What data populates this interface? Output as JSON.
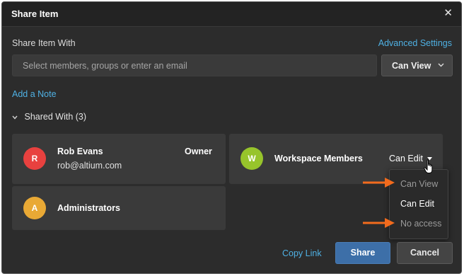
{
  "dialog": {
    "title": "Share Item",
    "close_glyph": "✕"
  },
  "share_with": {
    "label": "Share Item With",
    "advanced_link": "Advanced Settings",
    "input_placeholder": "Select members, groups or enter an email",
    "permission_value": "Can View",
    "permission_chevron": "⌄"
  },
  "add_note": "Add a Note",
  "shared_with": {
    "label": "Shared With (3)",
    "chevron": "⌄"
  },
  "members": [
    {
      "initial": "R",
      "name": "Rob Evans",
      "email": "rob@altium.com",
      "role": "Owner",
      "color": "#e8413f"
    },
    {
      "initial": "W",
      "name": "Workspace Members",
      "permission": "Can Edit",
      "color": "#97c42b"
    },
    {
      "initial": "A",
      "name": "Administrators",
      "color": "#e9a935"
    }
  ],
  "permission_menu": {
    "items": [
      "Can View",
      "Can Edit",
      "No access"
    ]
  },
  "footer": {
    "copy_link": "Copy Link",
    "share": "Share",
    "cancel": "Cancel"
  },
  "colors": {
    "accent_link": "#4fb1e4",
    "annotation_arrow": "#f26b1d",
    "primary_button": "#3d6fa8"
  }
}
